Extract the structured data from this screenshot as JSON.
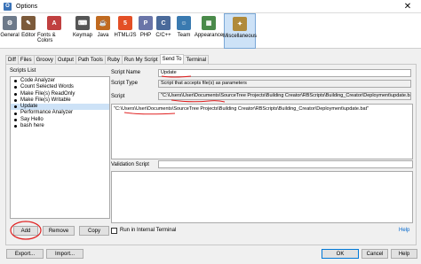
{
  "window": {
    "title": "Options",
    "close_glyph": "✕",
    "icon_glyph": "O"
  },
  "toolbar": [
    {
      "label": "General",
      "icon": "gear-icon",
      "color": "#6d7a8a",
      "glyph": "⚙"
    },
    {
      "label": "Editor",
      "icon": "editor-icon",
      "color": "#7c5a3a",
      "glyph": "✎"
    },
    {
      "label": "Fonts & Colors",
      "icon": "fonts-colors-icon",
      "color": "#c04040",
      "glyph": "A"
    },
    {
      "label": "Keymap",
      "icon": "keyboard-icon",
      "color": "#555555",
      "glyph": "⌨"
    },
    {
      "label": "Java",
      "icon": "java-icon",
      "color": "#c06a20",
      "glyph": "☕"
    },
    {
      "label": "HTML/JS",
      "icon": "html5-icon",
      "color": "#e34f26",
      "glyph": "5"
    },
    {
      "label": "PHP",
      "icon": "php-icon",
      "color": "#6a75a8",
      "glyph": "P"
    },
    {
      "label": "C/C++",
      "icon": "cpp-icon",
      "color": "#4a6a9a",
      "glyph": "C"
    },
    {
      "label": "Team",
      "icon": "team-icon",
      "color": "#3a7ab0",
      "glyph": "☺"
    },
    {
      "label": "Appearance",
      "icon": "appearance-icon",
      "color": "#4a8a4a",
      "glyph": "▦"
    },
    {
      "label": "Miscellaneous",
      "icon": "miscellaneous-icon",
      "color": "#b08a3a",
      "glyph": "✦"
    }
  ],
  "tabs": [
    "Diff",
    "Files",
    "Groovy",
    "Output",
    "Path Tools",
    "Ruby",
    "Run My Script",
    "Send To",
    "Terminal"
  ],
  "selected_tab": "Send To",
  "scripts": {
    "list_label": "Scripts List",
    "items": [
      "Code Analyzer",
      "Count Selected Words",
      "Make File(s) ReadOnly",
      "Make File(s) Writable",
      "Update",
      "Performance Analyzer",
      "Say Hello",
      "bash here"
    ],
    "selected": "Update",
    "add_label": "Add",
    "remove_label": "Remove",
    "copy_label": "Copy"
  },
  "form": {
    "script_name_label": "Script Name",
    "script_name_value": "Update",
    "script_type_label": "Script Type",
    "script_type_value": "Script that accepts file(s) as parameters",
    "script_label": "Script",
    "script_value": "\"C:\\Users\\User\\Documents\\SourceTree Projects\\Building Creator\\RBScripts\\Building_Creator\\Deployment\\update.bat\"",
    "script_body": "\"C:\\Users\\User\\Documents\\SourceTree Projects\\Building Creator\\RBScripts\\Building_Creator\\Deployment\\update.bat\"",
    "validation_label": "Validation Script",
    "run_terminal_label": "Run in Internal Terminal",
    "help_link": "Help"
  },
  "footer": {
    "export_label": "Export...",
    "import_label": "Import...",
    "ok_label": "OK",
    "cancel_label": "Cancel",
    "help_label": "Help"
  },
  "annotation_color": "#e02020"
}
